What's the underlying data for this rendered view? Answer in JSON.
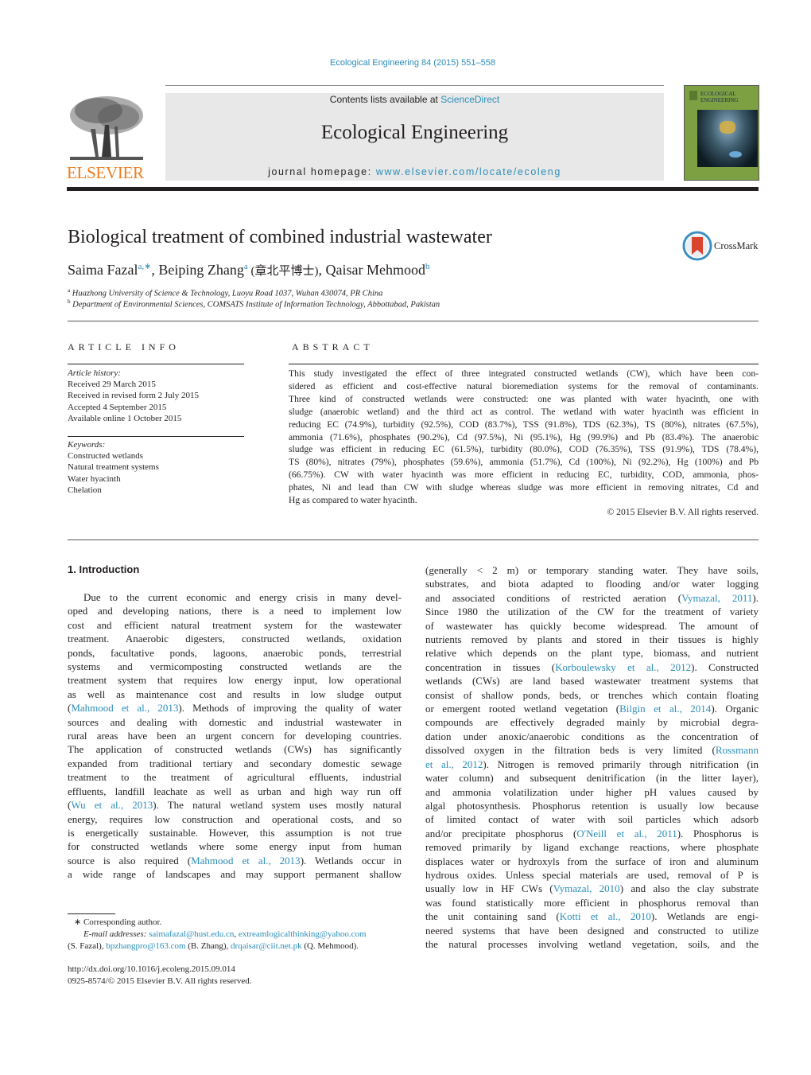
{
  "header": {
    "journal_ref": "Ecological Engineering 84 (2015) 551–558",
    "contents_prefix": "Contents lists available at ",
    "contents_link": "ScienceDirect",
    "journal_title": "Ecological Engineering",
    "homepage_prefix": "journal homepage: ",
    "homepage_link": "www.elsevier.com/locate/ecoleng",
    "publisher_logo": "ELSEVIER",
    "cover": {
      "title_line1": "ECOLOGICAL",
      "title_line2": "ENGINEERING"
    },
    "colors": {
      "link": "#2a8db8",
      "elsevier_orange": "#f07d1f",
      "banner_gray": "#e8e8e8"
    }
  },
  "article": {
    "title": "Biological treatment of combined industrial wastewater",
    "crossmark_label": "CrossMark",
    "authors": [
      {
        "name": "Saima Fazal",
        "sup": "a,∗"
      },
      {
        "name": "Beiping Zhang",
        "sup": "a",
        "note": " (章北平博士)"
      },
      {
        "name": "Qaisar Mehmood",
        "sup": "b"
      }
    ],
    "affiliations": [
      {
        "sup": "a",
        "text": "Huazhong University of Science & Technology, Luoyu Road 1037, Wuhan 430074, PR China"
      },
      {
        "sup": "b",
        "text": "Department of Environmental Sciences, COMSATS Institute of Information Technology, Abbottabad, Pakistan"
      }
    ]
  },
  "article_info": {
    "heading": "ARTICLE INFO",
    "history_label": "Article history:",
    "history": [
      "Received 29 March 2015",
      "Received in revised form 2 July 2015",
      "Accepted 4 September 2015",
      "Available online 1 October 2015"
    ],
    "keywords_label": "Keywords:",
    "keywords": [
      "Constructed wetlands",
      "Natural treatment systems",
      "Water hyacinth",
      "Chelation"
    ]
  },
  "abstract": {
    "heading": "ABSTRACT",
    "lines": [
      "This study investigated the effect of three integrated constructed wetlands (CW), which have been con-",
      "sidered as efficient and cost-effective natural bioremediation systems for the removal of contaminants.",
      "Three kind of constructed wetlands were constructed: one was planted with water hyacinth, one with",
      "sludge (anaerobic wetland) and the third act as control. The wetland with water hyacinth was efficient in",
      "reducing EC (74.9%), turbidity (92.5%), COD (83.7%), TSS (91.8%), TDS (62.3%), TS (80%), nitrates (67.5%),",
      "ammonia (71.6%), phosphates (90.2%), Cd (97.5%), Ni (95.1%), Hg (99.9%) and Pb (83.4%). The anaerobic",
      "sludge was efficient in reducing EC (61.5%), turbidity (80.0%), COD (76.35%), TSS (91.9%), TDS (78.4%),",
      "TS (80%), nitrates (79%), phosphates (59.6%), ammonia (51.7%), Cd (100%), Ni (92.2%), Hg (100%) and Pb",
      "(66.75%). CW with water hyacinth was more efficient in reducing EC, turbidity, COD, ammonia, phos-",
      "phates, Ni and lead than CW with sludge whereas sludge was more efficient in removing nitrates, Cd and",
      "Hg as compared to water hyacinth."
    ],
    "copyright": "© 2015 Elsevier B.V. All rights reserved."
  },
  "intro": {
    "heading": "1.  Introduction",
    "col1": [
      [
        {
          "t": "Due to the current economic and energy crisis in many devel-"
        }
      ],
      [
        {
          "t": "oped and developing nations, there is a need to implement low"
        }
      ],
      [
        {
          "t": "cost and efficient natural treatment system for the wastewater"
        }
      ],
      [
        {
          "t": "treatment. Anaerobic digesters, constructed wetlands, oxidation"
        }
      ],
      [
        {
          "t": "ponds, facultative ponds, lagoons, anaerobic ponds, terrestrial"
        }
      ],
      [
        {
          "t": "systems and vermicomposting constructed wetlands are the"
        }
      ],
      [
        {
          "t": "treatment system that requires low energy input, low operational"
        }
      ],
      [
        {
          "t": "as well as maintenance cost and results in low sludge output"
        }
      ],
      [
        {
          "t": "("
        },
        {
          "t": "Mahmood et al., 2013",
          "link": true
        },
        {
          "t": "). Methods of improving the quality of water"
        }
      ],
      [
        {
          "t": "sources and dealing with domestic and industrial wastewater in"
        }
      ],
      [
        {
          "t": "rural areas have been an urgent concern for developing countries."
        }
      ],
      [
        {
          "t": "The application of constructed wetlands (CWs) has significantly"
        }
      ],
      [
        {
          "t": "expanded from traditional tertiary and secondary domestic sewage"
        }
      ],
      [
        {
          "t": "treatment to the treatment of agricultural effluents, industrial"
        }
      ],
      [
        {
          "t": "effluents, landfill leachate as well as urban and high way run off"
        }
      ],
      [
        {
          "t": "("
        },
        {
          "t": "Wu et al., 2013",
          "link": true
        },
        {
          "t": "). The natural wetland system uses mostly natural"
        }
      ],
      [
        {
          "t": "energy, requires low construction and operational costs, and so"
        }
      ],
      [
        {
          "t": "is energetically sustainable. However, this assumption is not true"
        }
      ],
      [
        {
          "t": "for constructed wetlands where some energy input from human"
        }
      ],
      [
        {
          "t": "source is also required ("
        },
        {
          "t": "Mahmood et al., 2013",
          "link": true
        },
        {
          "t": "). Wetlands occur in"
        }
      ],
      [
        {
          "t": "a wide range of landscapes and may support permanent shallow"
        }
      ]
    ],
    "col2": [
      [
        {
          "t": "(generally < 2 m) or temporary standing water. They have soils,"
        }
      ],
      [
        {
          "t": "substrates, and biota adapted to flooding and/or water logging"
        }
      ],
      [
        {
          "t": "and associated conditions of restricted aeration ("
        },
        {
          "t": "Vymazal, 2011",
          "link": true
        },
        {
          "t": ")."
        }
      ],
      [
        {
          "t": "Since 1980 the utilization of the CW for the treatment of variety"
        }
      ],
      [
        {
          "t": "of wastewater has quickly become widespread. The amount of"
        }
      ],
      [
        {
          "t": "nutrients removed by plants and stored in their tissues is highly"
        }
      ],
      [
        {
          "t": "relative which depends on the plant type, biomass, and nutrient"
        }
      ],
      [
        {
          "t": "concentration in tissues ("
        },
        {
          "t": "Korboulewsky et al., 2012",
          "link": true
        },
        {
          "t": "). Constructed"
        }
      ],
      [
        {
          "t": "wetlands (CWs) are land based wastewater treatment systems that"
        }
      ],
      [
        {
          "t": "consist of shallow ponds, beds, or trenches which contain floating"
        }
      ],
      [
        {
          "t": "or emergent rooted wetland vegetation ("
        },
        {
          "t": "Bilgin et al., 2014",
          "link": true
        },
        {
          "t": "). Organic"
        }
      ],
      [
        {
          "t": "compounds are effectively degraded mainly by microbial degra-"
        }
      ],
      [
        {
          "t": "dation under anoxic/anaerobic conditions as the concentration of"
        }
      ],
      [
        {
          "t": "dissolved oxygen in the filtration beds is very limited ("
        },
        {
          "t": "Rossmann",
          "link": true
        }
      ],
      [
        {
          "t": "et al., 2012",
          "link": true
        },
        {
          "t": "). Nitrogen is removed primarily through nitrification (in"
        }
      ],
      [
        {
          "t": "water column) and subsequent denitrification (in the litter layer),"
        }
      ],
      [
        {
          "t": "and ammonia volatilization under higher pH values caused by"
        }
      ],
      [
        {
          "t": "algal photosynthesis. Phosphorus retention is usually low because"
        }
      ],
      [
        {
          "t": "of limited contact of water with soil particles which adsorb"
        }
      ],
      [
        {
          "t": "and/or precipitate phosphorus ("
        },
        {
          "t": "O'Neill et al., 2011",
          "link": true
        },
        {
          "t": "). Phosphorus is"
        }
      ],
      [
        {
          "t": "removed primarily by ligand exchange reactions, where phosphate"
        }
      ],
      [
        {
          "t": "displaces water or hydroxyls from the surface of iron and aluminum"
        }
      ],
      [
        {
          "t": "hydrous oxides. Unless special materials are used, removal of P is"
        }
      ],
      [
        {
          "t": "usually low in HF CWs ("
        },
        {
          "t": "Vymazal, 2010",
          "link": true
        },
        {
          "t": ") and also the clay substrate"
        }
      ],
      [
        {
          "t": "was found statistically more efficient in phosphorus removal than"
        }
      ],
      [
        {
          "t": "the unit containing sand ("
        },
        {
          "t": "Kotti et al., 2010",
          "link": true
        },
        {
          "t": "). Wetlands are engi-"
        }
      ],
      [
        {
          "t": "neered systems that have been designed and constructed to utilize"
        }
      ],
      [
        {
          "t": "the natural processes involving wetland vegetation, soils, and the"
        }
      ]
    ]
  },
  "footnotes": {
    "corresponding": "∗  Corresponding author.",
    "email_label": "E-mail addresses: ",
    "emails": [
      {
        "addr": "saimafazal@hust.edu.cn"
      },
      {
        "addr": "extreamlogicalthinking@yahoo.com",
        "who": "(S. Fazal)"
      },
      {
        "addr": "bpzhangpro@163.com",
        "who": "(B. Zhang)"
      },
      {
        "addr": "drqaisar@ciit.net.pk",
        "who": "(Q. Mehmood)."
      }
    ],
    "doi": "http://dx.doi.org/10.1016/j.ecoleng.2015.09.014",
    "issn": "0925-8574/© 2015 Elsevier B.V. All rights reserved."
  }
}
